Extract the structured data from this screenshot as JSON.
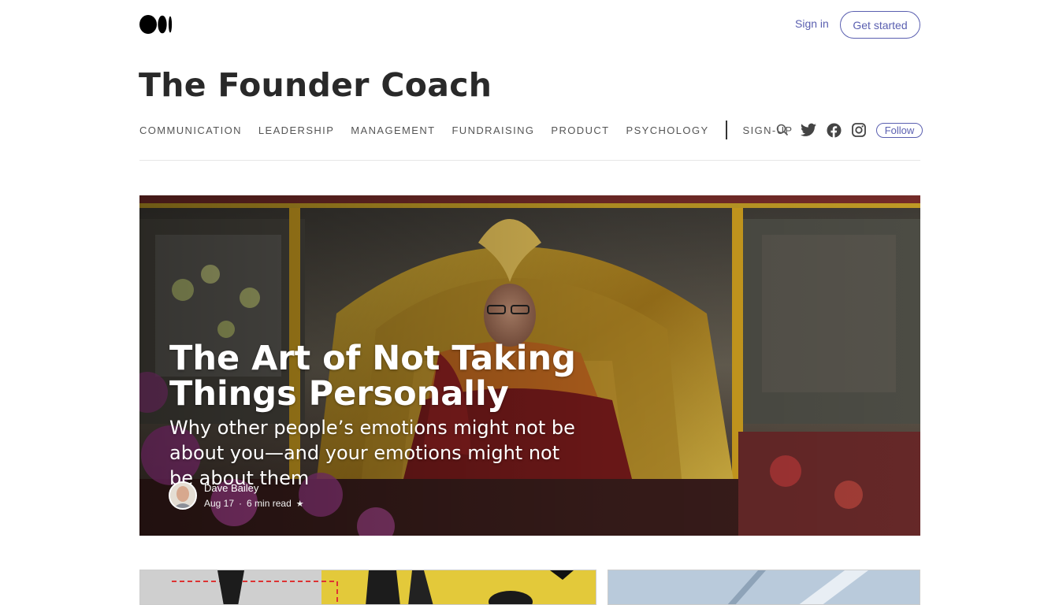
{
  "header": {
    "logo_icon": "medium-logo-icon",
    "sign_in": "Sign in",
    "get_started": "Get started"
  },
  "publication": {
    "title": "The Founder Coach"
  },
  "nav": {
    "items": [
      "COMMUNICATION",
      "LEADERSHIP",
      "MANAGEMENT",
      "FUNDRAISING",
      "PRODUCT",
      "PSYCHOLOGY"
    ],
    "signup": "SIGN-UP",
    "icons": [
      "search-icon",
      "twitter-icon",
      "facebook-icon",
      "instagram-icon"
    ],
    "follow": "Follow"
  },
  "featured": {
    "title": "The Art of Not Taking Things Personally",
    "subtitle": "Why other people’s emotions might not be about you—and your emotions might not be about them",
    "author": "Dave Bailey",
    "date": "Aug 17",
    "read_time": "6 min read",
    "star": "★"
  },
  "colors": {
    "accent": "#5a5fb0",
    "text": "#292929"
  }
}
